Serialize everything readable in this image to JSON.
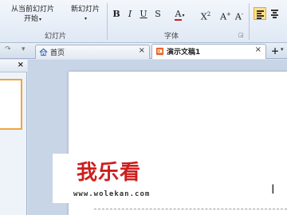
{
  "ribbon": {
    "from_current_line1": "从当前幻灯片",
    "from_current_line2": "开始",
    "new_slide": "新幻灯片",
    "group_slides": "幻灯片",
    "group_font": "字体",
    "format_buttons": [
      "B",
      "I",
      "U",
      "S",
      "A",
      "X",
      "A",
      "A"
    ],
    "superscript_mark": "2",
    "enlarge_mark": "+",
    "shrink_mark": "-"
  },
  "tabs": {
    "home_label": "首页",
    "doc_label": "演示文稿1",
    "close_glyph": "×",
    "new_tab": "+"
  },
  "side_panel": {
    "close_glyph": "×"
  },
  "slide": {
    "partial_text": "I"
  },
  "watermark": {
    "title": "我乐看",
    "url": "www.wolekan.com"
  },
  "colors": {
    "accent_orange": "#f0a53b",
    "watermark_red": "#cc1f1f",
    "ribbon_bg": "#e6edf6"
  }
}
